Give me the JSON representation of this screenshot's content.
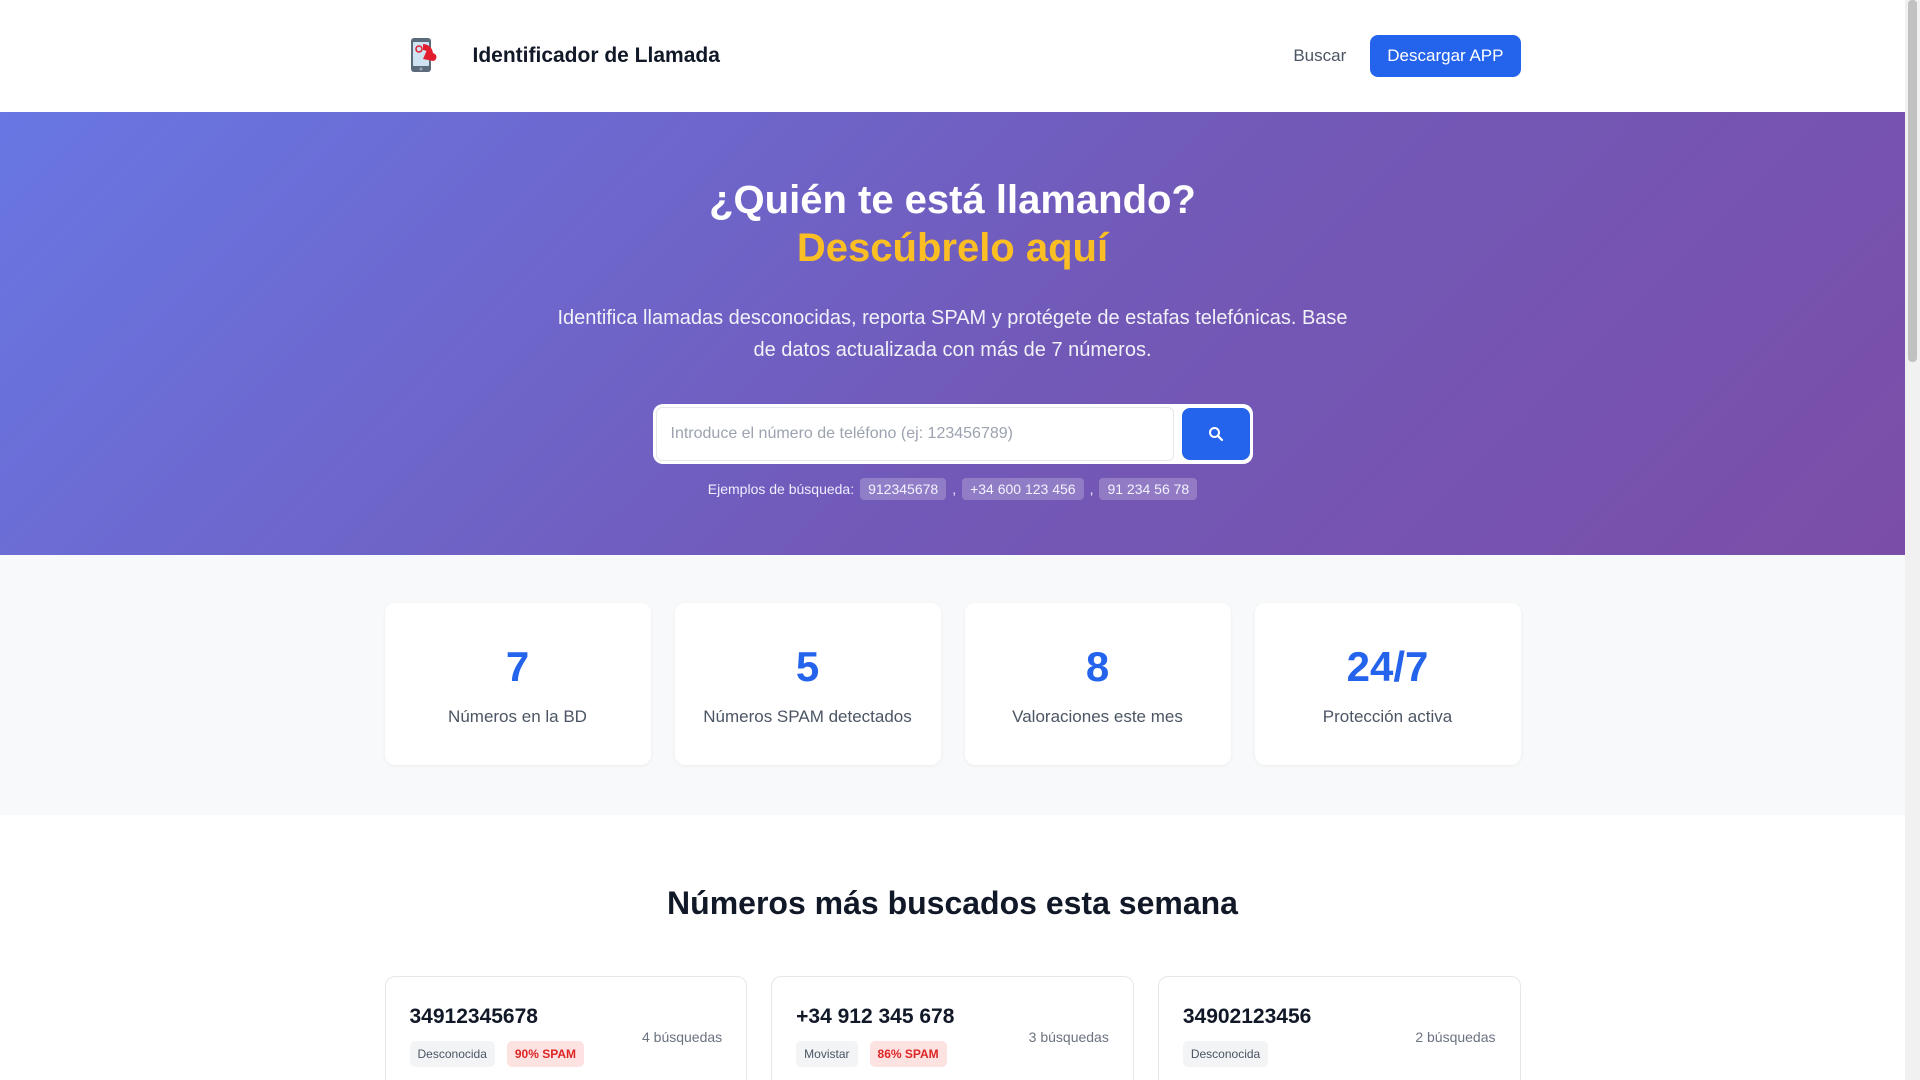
{
  "header": {
    "brand": "Identificador de Llamada",
    "nav_search": "Buscar",
    "download_btn": "Descargar APP"
  },
  "hero": {
    "title": "¿Quién te está llamando?",
    "title_accent": "Descúbrelo aquí",
    "lead": "Identifica llamadas desconocidas, reporta SPAM y protégete de estafas telefónicas. Base de datos actualizada con más de 7 números.",
    "search_placeholder": "Introduce el número de teléfono (ej: 123456789)",
    "examples_label": "Ejemplos de búsqueda:",
    "examples": [
      "912345678",
      "+34 600 123 456",
      "91 234 56 78"
    ],
    "separator": ","
  },
  "stats": [
    {
      "value": "7",
      "label": "Números en la BD"
    },
    {
      "value": "5",
      "label": "Números SPAM detectados"
    },
    {
      "value": "8",
      "label": "Valoraciones este mes"
    },
    {
      "value": "24/7",
      "label": "Protección activa"
    }
  ],
  "most_searched": {
    "title": "Números más buscados esta semana",
    "items": [
      {
        "number": "34912345678",
        "operator": "Desconocida",
        "spam": "90% SPAM",
        "searches": "4 búsquedas"
      },
      {
        "number": "+34 912 345 678",
        "operator": "Movistar",
        "spam": "86% SPAM",
        "searches": "3 búsquedas"
      },
      {
        "number": "34902123456",
        "operator": "Desconocida",
        "searches": "2 búsquedas"
      }
    ]
  },
  "colors": {
    "primary": "#2463eb",
    "accent": "#fbbf24",
    "spam": "#dc2626"
  }
}
